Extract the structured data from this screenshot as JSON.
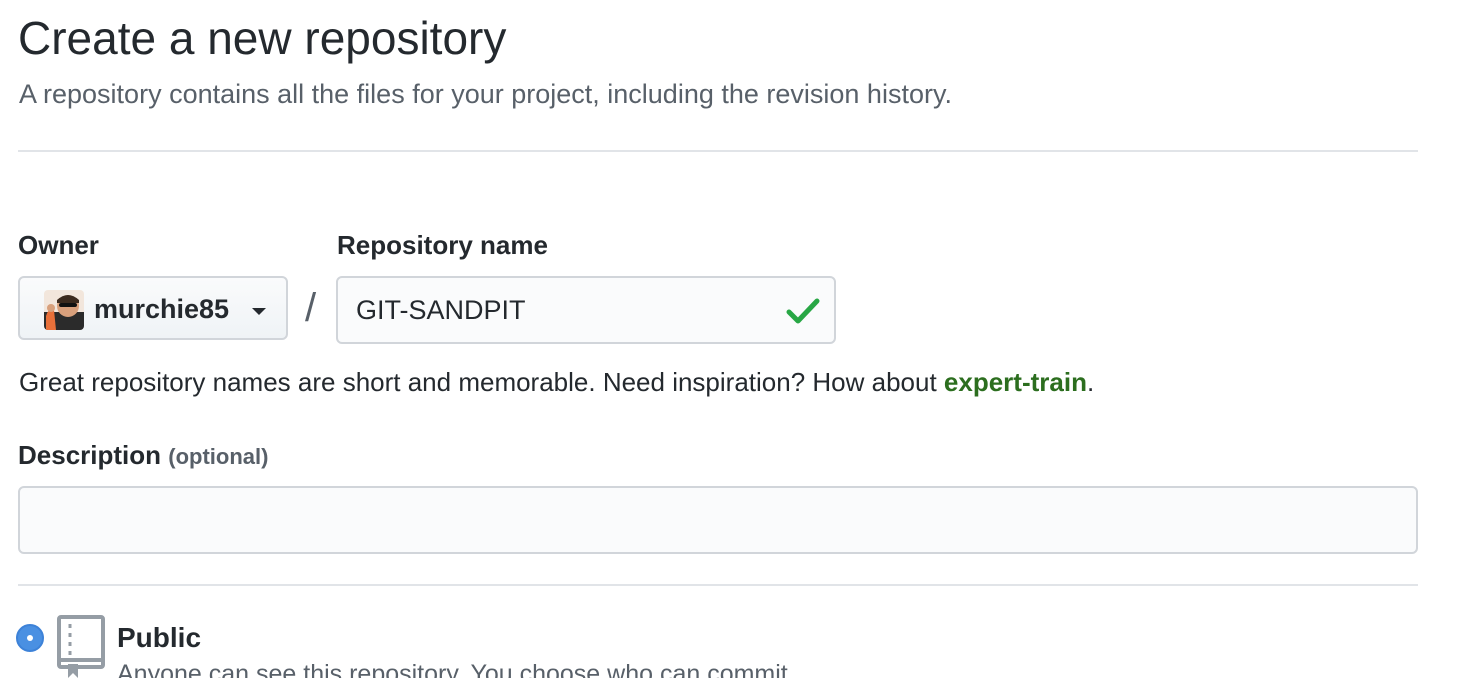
{
  "header": {
    "title": "Create a new repository",
    "subtitle": "A repository contains all the files for your project, including the revision history."
  },
  "owner": {
    "label": "Owner",
    "value": "murchie85",
    "avatar_icon": "user-avatar"
  },
  "separator": "/",
  "repository_name": {
    "label": "Repository name",
    "value": "GIT-SANDPIT",
    "status_icon": "check-icon",
    "status_color": "#28a745"
  },
  "name_hint": {
    "text": "Great repository names are short and memorable. Need inspiration? How about ",
    "suggestion": "expert-train",
    "suffix": "."
  },
  "description": {
    "label": "Description",
    "optional": "(optional)",
    "value": "",
    "placeholder": ""
  },
  "visibility": {
    "selected": "public",
    "public": {
      "label": "Public",
      "description": "Anyone can see this repository. You choose who can commit.",
      "icon": "repo-icon"
    }
  },
  "colors": {
    "link_green": "#2c6e1f",
    "radio_blue": "#4a90e2",
    "border": "#d1d5da",
    "muted_text": "#586069"
  }
}
